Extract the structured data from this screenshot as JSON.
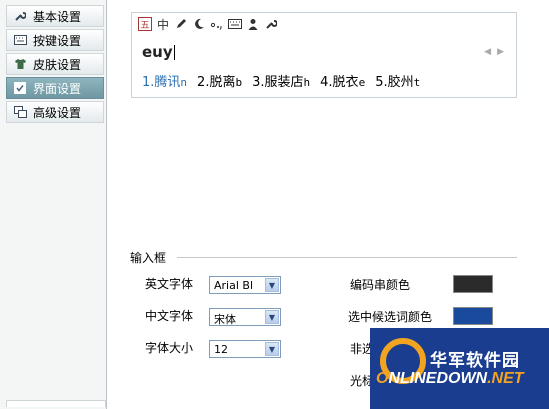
{
  "sidebar": {
    "items": [
      {
        "label": "基本设置",
        "icon": "wrench-icon",
        "active": false
      },
      {
        "label": "按键设置",
        "icon": "keyboard-icon",
        "active": false
      },
      {
        "label": "皮肤设置",
        "icon": "shirt-icon",
        "active": false
      },
      {
        "label": "界面设置",
        "icon": "window-check-icon",
        "active": true
      },
      {
        "label": "高级设置",
        "icon": "windows-stack-icon",
        "active": false
      }
    ]
  },
  "preview": {
    "toolbar": {
      "logo": "五",
      "mode": "中"
    },
    "composition": "euy",
    "candidates": [
      {
        "index": "1.",
        "text": "腾讯",
        "hint": "n"
      },
      {
        "index": "2.",
        "text": "脱离",
        "hint": "b"
      },
      {
        "index": "3.",
        "text": "服装店",
        "hint": "h"
      },
      {
        "index": "4.",
        "text": "脱衣",
        "hint": "e"
      },
      {
        "index": "5.",
        "text": "胶州",
        "hint": "t"
      }
    ]
  },
  "input_box": {
    "section_title": "输入框",
    "english_font_label": "英文字体",
    "english_font_value": "Arial Bl",
    "chinese_font_label": "中文字体",
    "chinese_font_value": "宋体",
    "font_size_label": "字体大小",
    "font_size_value": "12",
    "code_color_label": "编码串颜色",
    "code_color": "#2b2b2b",
    "selected_color_label": "选中候选词颜色",
    "selected_color": "#1a4a9c",
    "unselected_color_label_partial": "非选",
    "cursor_label_partial": "光标"
  },
  "colors": {
    "accent": "#2a6fb0",
    "sidebar_active": "#7ea5b0"
  },
  "watermark": {
    "cn": "华军软件园",
    "en_a": "NLINEDOWN",
    "en_b": ".NET",
    "en_o": "O"
  }
}
